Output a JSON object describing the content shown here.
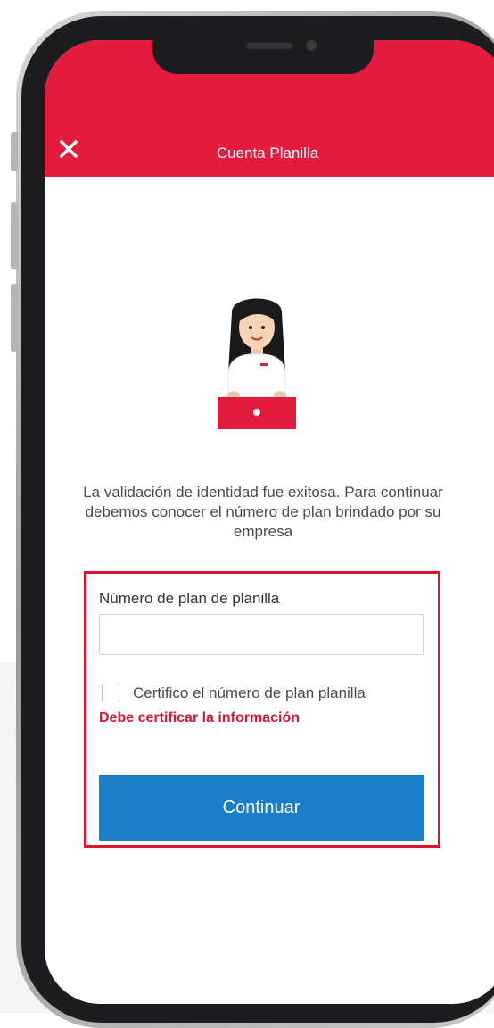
{
  "header": {
    "title": "Cuenta Planilla",
    "close_icon": "close-icon",
    "background_color": "#e31c3d"
  },
  "main": {
    "illustration": "woman-with-laptop-illustration",
    "intro_text": "La validación de identidad fue exitosa. Para continuar debemos conocer el número de plan brindado por su empresa"
  },
  "form": {
    "plan_label": "Número de plan de planilla",
    "plan_value": "",
    "plan_placeholder": "",
    "certify_label": "Certifico el número de plan planilla",
    "certify_checked": false,
    "error_message": "Debe certificar la información",
    "submit_label": "Continuar"
  },
  "colors": {
    "brand_red": "#e31c3d",
    "error_red": "#e0132f",
    "button_blue": "#1b7ec8"
  }
}
